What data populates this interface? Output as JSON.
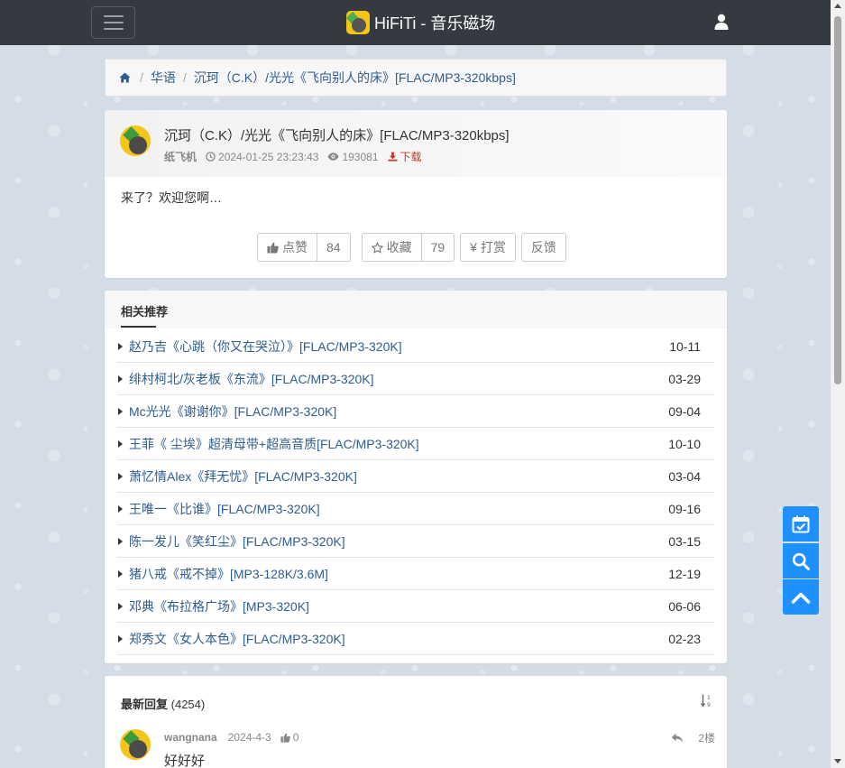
{
  "navbar": {
    "brand": "HiFiTi - 音乐磁场",
    "toggle_icon": "hamburger-icon",
    "user_icon": "user-icon"
  },
  "breadcrumb": {
    "home_icon": "home-icon",
    "items": [
      "华语",
      "沉珂（C.K）/光光《飞向别人的床》[FLAC/MP3-320kbps]"
    ]
  },
  "thread": {
    "title": "沉珂（C.K）/光光《飞向别人的床》[FLAC/MP3-320kbps]",
    "author": "纸飞机",
    "datetime": "2024-01-25 23:23:43",
    "views": "193081",
    "download_label": "下载",
    "body": "来了？欢迎您啊…",
    "actions": {
      "like_label": "点赞",
      "like_count": "84",
      "fav_label": "收藏",
      "fav_count": "79",
      "tip_label": "¥ 打赏",
      "feedback_label": "反馈"
    }
  },
  "related": {
    "title": "相关推荐",
    "items": [
      {
        "title": "赵乃吉《心跳（你又在哭泣）》[FLAC/MP3-320K]",
        "date": "10-11"
      },
      {
        "title": "绯村柯北/灰老板《东流》[FLAC/MP3-320K]",
        "date": "03-29"
      },
      {
        "title": "Mc光光《谢谢你》[FLAC/MP3-320K]",
        "date": "09-04"
      },
      {
        "title": "王菲《 尘埃》超清母带+超高音质[FLAC/MP3-320K]",
        "date": "10-10"
      },
      {
        "title": "萧忆情Alex《拜无忧》[FLAC/MP3-320K]",
        "date": "03-04"
      },
      {
        "title": "王唯一《比谁》[FLAC/MP3-320K]",
        "date": "09-16"
      },
      {
        "title": "陈一发儿《笑红尘》[FLAC/MP3-320K]",
        "date": "03-15"
      },
      {
        "title": "猪八戒《戒不掉》[MP3-128K/3.6M]",
        "date": "12-19"
      },
      {
        "title": "邓典《布拉格广场》[MP3-320K]",
        "date": "06-06"
      },
      {
        "title": "郑秀文《女人本色》[FLAC/MP3-320K]",
        "date": "02-23"
      }
    ]
  },
  "replies": {
    "title": "最新回复",
    "count": "(4254)",
    "sort_icon": "sort-numeric-icon",
    "items": [
      {
        "user": "wangnana",
        "date": "2024-4-3",
        "likes": "0",
        "floor": "2楼",
        "text": "好好好"
      }
    ]
  },
  "float_buttons": [
    "calendar-check-icon",
    "search-icon",
    "chevron-up-icon"
  ],
  "colors": {
    "navbar_bg": "#343a40",
    "link": "#2f5c8f",
    "download": "#c0392b",
    "float_btn": "#1e90ff",
    "page_bg": "#d4dde5"
  }
}
